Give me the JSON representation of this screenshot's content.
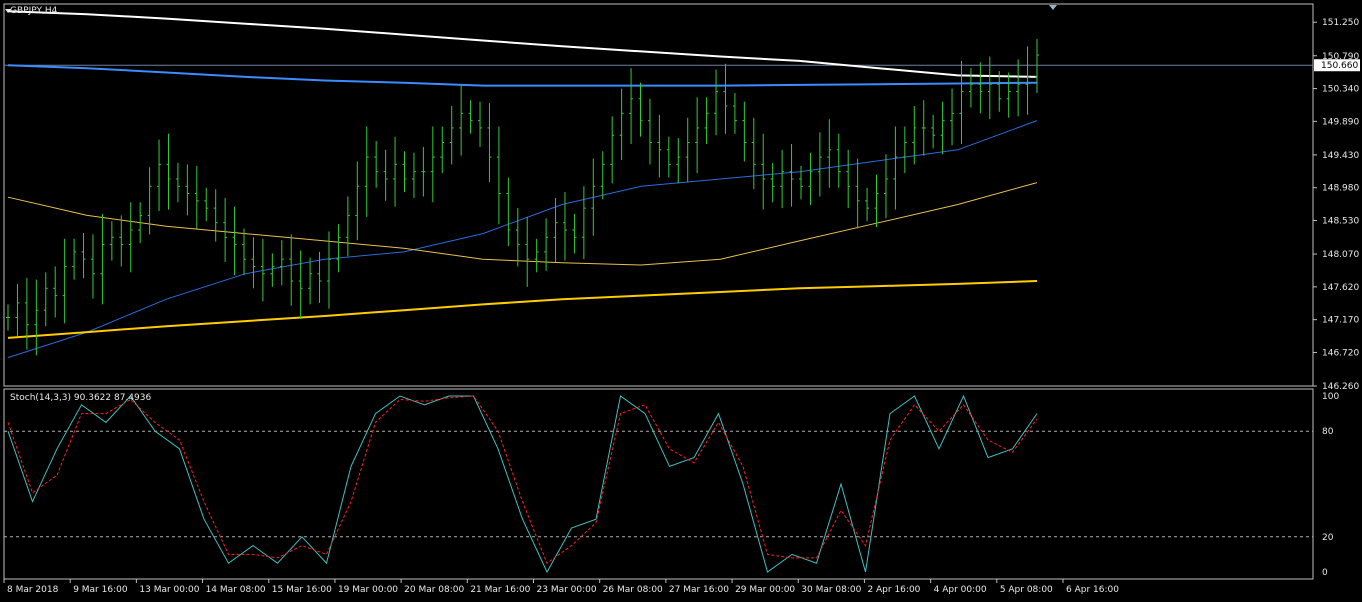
{
  "chart_data": [
    {
      "type": "candlestick",
      "title": "GBPJPY,H4",
      "current_price": "150.660",
      "ylim": [
        146.26,
        151.5
      ],
      "y_ticks": [
        "151.250",
        "150.790",
        "150.340",
        "149.890",
        "149.430",
        "148.980",
        "148.530",
        "148.070",
        "147.620",
        "147.170",
        "146.720",
        "146.260"
      ],
      "x_tick_labels": [
        "8 Mar 2018",
        "9 Mar 16:00",
        "13 Mar 00:00",
        "14 Mar 08:00",
        "15 Mar 16:00",
        "19 Mar 00:00",
        "20 Mar 08:00",
        "21 Mar 16:00",
        "23 Mar 00:00",
        "26 Mar 08:00",
        "27 Mar 16:00",
        "29 Mar 00:00",
        "30 Mar 08:00",
        "2 Apr 16:00",
        "4 Apr 00:00",
        "5 Apr 08:00",
        "6 Apr 16:00"
      ],
      "bar_color": "#33cc33",
      "closes": [
        147.2,
        147.4,
        147.1,
        147.3,
        147.6,
        147.5,
        147.9,
        148.1,
        148.0,
        147.8,
        148.2,
        148.3,
        148.2,
        148.4,
        148.6,
        149.0,
        149.3,
        149.1,
        149.0,
        148.9,
        148.8,
        148.7,
        148.5,
        148.3,
        148.2,
        148.0,
        147.9,
        147.8,
        147.9,
        148.0,
        147.7,
        147.6,
        147.8,
        147.7,
        148.0,
        148.3,
        148.6,
        149.0,
        149.4,
        149.2,
        149.1,
        149.3,
        149.1,
        149.2,
        149.2,
        149.4,
        149.6,
        149.8,
        150.0,
        149.9,
        149.8,
        149.4,
        148.9,
        148.4,
        148.2,
        148.0,
        148.1,
        148.3,
        148.5,
        148.4,
        148.3,
        148.7,
        149.0,
        149.3,
        149.7,
        150.0,
        150.2,
        149.9,
        149.6,
        149.5,
        149.3,
        149.4,
        149.6,
        149.8,
        150.0,
        150.3,
        150.1,
        149.9,
        149.6,
        149.3,
        149.1,
        149.0,
        149.2,
        149.1,
        149.0,
        149.2,
        149.4,
        149.5,
        149.2,
        149.0,
        148.8,
        148.7,
        148.9,
        149.1,
        149.4,
        149.6,
        149.8,
        149.8,
        149.7,
        149.9,
        150.0,
        150.3,
        150.4,
        150.3,
        150.4,
        150.2,
        150.3,
        150.4,
        150.5,
        150.8
      ],
      "ma_lines": [
        {
          "color": "#ffffff",
          "width": 2.0,
          "values": [
            151.4,
            151.36,
            151.3,
            151.23,
            151.16,
            151.08,
            151.0,
            150.92,
            150.85,
            150.78,
            150.72,
            150.62,
            150.52,
            150.5
          ]
        },
        {
          "color": "#3a8cff",
          "width": 2.0,
          "values": [
            150.66,
            150.62,
            150.56,
            150.5,
            150.45,
            150.42,
            150.38,
            150.38,
            150.38,
            150.38,
            150.39,
            150.4,
            150.41,
            150.42
          ]
        },
        {
          "color": "#2a6cdd",
          "width": 1.0,
          "values": [
            146.65,
            147.0,
            147.45,
            147.8,
            148.0,
            148.1,
            148.35,
            148.75,
            149.0,
            149.1,
            149.2,
            149.35,
            149.5,
            149.9
          ]
        },
        {
          "color": "#e8c050",
          "width": 1.0,
          "values": [
            148.85,
            148.6,
            148.45,
            148.35,
            148.25,
            148.15,
            148.0,
            147.95,
            147.92,
            148.0,
            148.25,
            148.5,
            148.75,
            149.05
          ]
        },
        {
          "color": "#ffcc00",
          "width": 2.0,
          "values": [
            146.92,
            147.0,
            147.08,
            147.15,
            147.22,
            147.3,
            147.38,
            147.45,
            147.5,
            147.55,
            147.6,
            147.63,
            147.66,
            147.7
          ]
        }
      ]
    },
    {
      "type": "line",
      "title": "Stoch(14,3,3) 90.3622 87.4936",
      "ylim": [
        0,
        100
      ],
      "y_ticks": [
        "100",
        "80",
        "20",
        "0"
      ],
      "levels": [
        80,
        20
      ],
      "series": [
        {
          "color": "#40c0c0",
          "dashed": false,
          "values": [
            80,
            40,
            70,
            95,
            85,
            100,
            80,
            70,
            30,
            5,
            15,
            5,
            20,
            5,
            60,
            90,
            100,
            95,
            100,
            100,
            70,
            30,
            0,
            25,
            30,
            100,
            90,
            60,
            65,
            90,
            50,
            0,
            10,
            5,
            50,
            0,
            90,
            100,
            70,
            100,
            65,
            70,
            90
          ]
        },
        {
          "color": "#ff2020",
          "dashed": true,
          "values": [
            85,
            45,
            55,
            90,
            90,
            98,
            85,
            75,
            40,
            10,
            10,
            8,
            15,
            10,
            40,
            85,
            98,
            97,
            99,
            100,
            80,
            40,
            5,
            15,
            28,
            90,
            95,
            70,
            62,
            85,
            60,
            10,
            8,
            8,
            35,
            15,
            75,
            95,
            80,
            95,
            75,
            68,
            87
          ]
        }
      ]
    }
  ]
}
